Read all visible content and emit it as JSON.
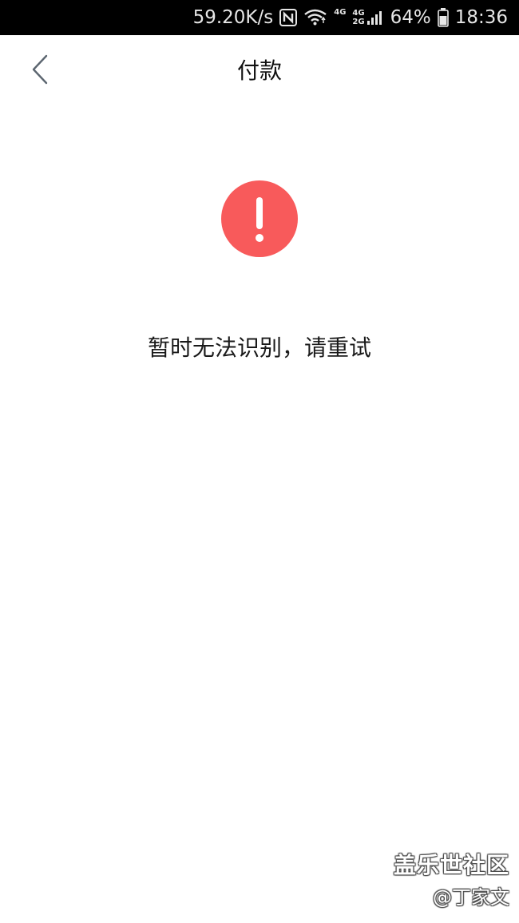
{
  "status_bar": {
    "network_speed": "59.20K/s",
    "network_tag_1": "4G",
    "network_tag_2a": "4G",
    "network_tag_2b": "2G",
    "battery_percent": "64%",
    "time": "18:36",
    "icons": [
      "nfc-icon",
      "wifi-icon",
      "signal-icon",
      "battery-icon"
    ]
  },
  "nav": {
    "title": "付款"
  },
  "alert": {
    "icon": "exclamation-icon",
    "color": "#f85a5b",
    "message": "暂时无法识别，请重试"
  },
  "watermark": {
    "site": "盖乐世社区",
    "author": "@丁家文"
  }
}
